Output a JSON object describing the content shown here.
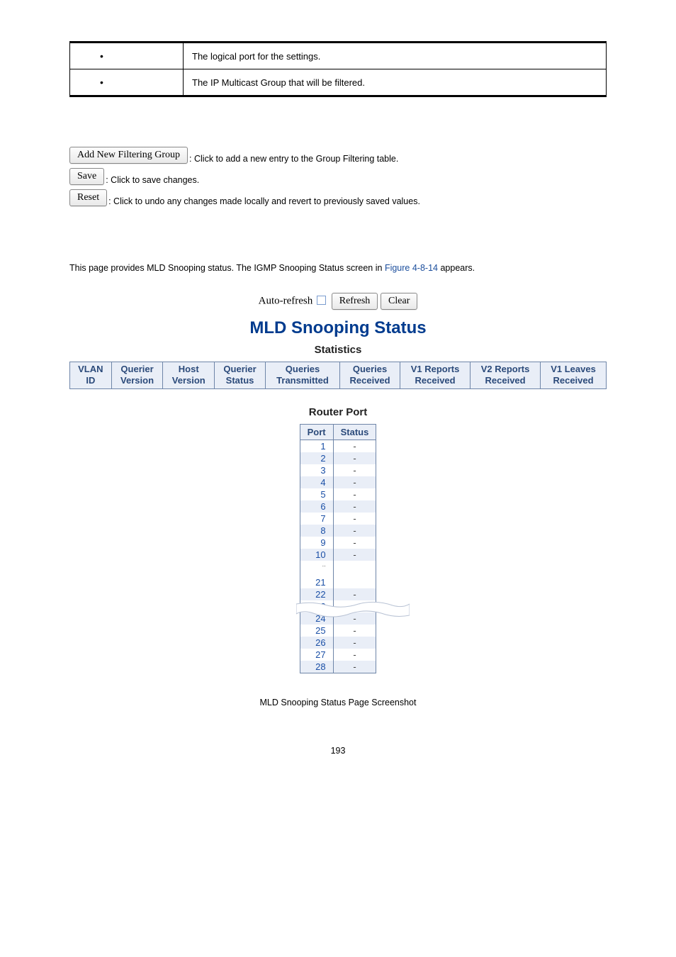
{
  "top_table": {
    "row1": "The logical port for the settings.",
    "row2": "The IP Multicast Group that will be filtered."
  },
  "buttons": {
    "add_group": "Add New Filtering Group",
    "add_group_desc": ": Click to add a new entry to the Group Filtering table.",
    "save": "Save",
    "save_desc": ": Click to save changes.",
    "reset": "Reset",
    "reset_desc": ": Click to undo any changes made locally and revert to previously saved values."
  },
  "intro": {
    "before": "This page provides MLD Snooping status. The IGMP Snooping Status screen in ",
    "figref": "Figure 4-8-14",
    "after": " appears."
  },
  "auto_row": {
    "label": "Auto-refresh",
    "refresh": "Refresh",
    "clear": "Clear"
  },
  "titles": {
    "main": "MLD Snooping Status",
    "stats": "Statistics",
    "router": "Router Port"
  },
  "chart_data": {
    "type": "table",
    "stats_headers": [
      {
        "line1": "VLAN",
        "line2": "ID"
      },
      {
        "line1": "Querier",
        "line2": "Version"
      },
      {
        "line1": "Host",
        "line2": "Version"
      },
      {
        "line1": "Querier",
        "line2": "Status"
      },
      {
        "line1": "Queries",
        "line2": "Transmitted"
      },
      {
        "line1": "Queries",
        "line2": "Received"
      },
      {
        "line1": "V1 Reports",
        "line2": "Received"
      },
      {
        "line1": "V2 Reports",
        "line2": "Received"
      },
      {
        "line1": "V1 Leaves",
        "line2": "Received"
      }
    ],
    "router_headers": {
      "port": "Port",
      "status": "Status"
    },
    "router_rows_top": [
      {
        "port": "1",
        "status": "-",
        "even": false
      },
      {
        "port": "2",
        "status": "-",
        "even": true
      },
      {
        "port": "3",
        "status": "-",
        "even": false
      },
      {
        "port": "4",
        "status": "-",
        "even": true
      },
      {
        "port": "5",
        "status": "-",
        "even": false
      },
      {
        "port": "6",
        "status": "-",
        "even": true
      },
      {
        "port": "7",
        "status": "-",
        "even": false
      },
      {
        "port": "8",
        "status": "-",
        "even": true
      },
      {
        "port": "9",
        "status": "-",
        "even": false
      },
      {
        "port": "10",
        "status": "-",
        "even": true
      }
    ],
    "router_break": "..",
    "router_rows_bottom": [
      {
        "port": "21",
        "status": "",
        "even": false
      },
      {
        "port": "22",
        "status": "-",
        "even": true
      },
      {
        "port": "23",
        "status": "-",
        "even": false
      },
      {
        "port": "24",
        "status": "-",
        "even": true
      },
      {
        "port": "25",
        "status": "-",
        "even": false
      },
      {
        "port": "26",
        "status": "-",
        "even": true
      },
      {
        "port": "27",
        "status": "-",
        "even": false
      },
      {
        "port": "28",
        "status": "-",
        "even": true
      }
    ]
  },
  "caption": "MLD Snooping Status Page Screenshot",
  "page_num": "193"
}
